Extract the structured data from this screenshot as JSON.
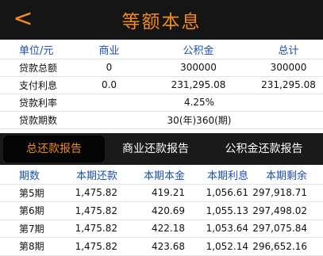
{
  "header": {
    "back_icon": "<",
    "title": "等额本息"
  },
  "summary": {
    "headers": [
      "单位/元",
      "商业",
      "公积金",
      "总计"
    ],
    "rows": [
      [
        "贷款总额",
        "0",
        "300000",
        "300000"
      ],
      [
        "支付利息",
        "0.0",
        "231,295.08",
        "231,295.08"
      ]
    ],
    "rate": {
      "label": "贷款利率",
      "value": "4.25%"
    },
    "period": {
      "label": "贷款期数",
      "value": "30(年)360(期)"
    }
  },
  "tabs": [
    "总还款报告",
    "商业还款报告",
    "公积金还款报告"
  ],
  "active_tab": 0,
  "schedule": {
    "headers": [
      "期数",
      "本期还款",
      "本期本金",
      "本期利息",
      "本期剩余"
    ],
    "rows": [
      [
        "第5期",
        "1,475.82",
        "419.21",
        "1,056.61",
        "297,918.71"
      ],
      [
        "第6期",
        "1,475.82",
        "420.69",
        "1,055.13",
        "297,498.02"
      ],
      [
        "第7期",
        "1,475.82",
        "422.18",
        "1,053.64",
        "297,075.84"
      ],
      [
        "第8期",
        "1,475.82",
        "423.68",
        "1,052.14",
        "296,652.16"
      ]
    ]
  },
  "colors": {
    "accent": "#f08a1c",
    "header_text": "#1a4fb5",
    "bar_bg": "#151515"
  }
}
